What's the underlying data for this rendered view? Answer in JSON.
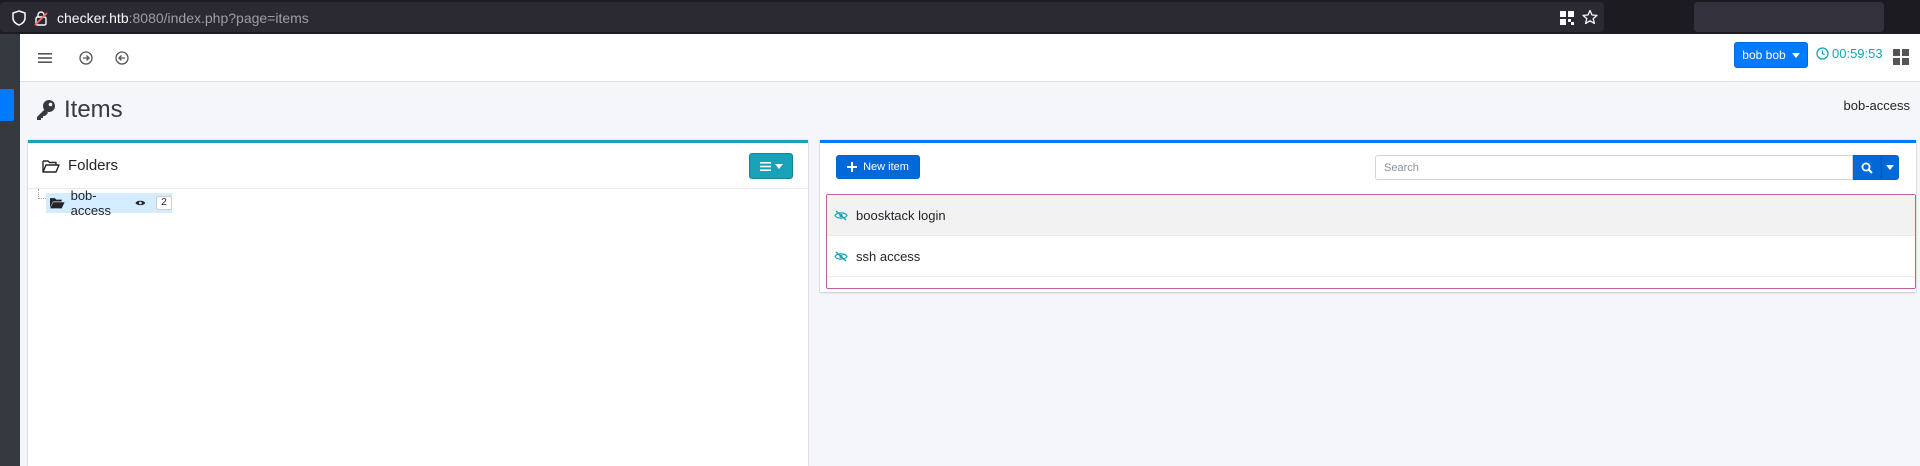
{
  "browser": {
    "url_host": "checker.htb",
    "url_rest": ":8080/index.php?page=items"
  },
  "navbar": {
    "user_label": "bob bob",
    "timer": "00:59:53"
  },
  "page": {
    "title": "Items",
    "breadcrumb": "bob-access"
  },
  "folders": {
    "title": "Folders",
    "tree": [
      {
        "label": "bob-access",
        "count": "2"
      }
    ]
  },
  "items_panel": {
    "new_item_label": "New item",
    "search_placeholder": "Search",
    "items": [
      {
        "label": "boosktack login"
      },
      {
        "label": "ssh access"
      }
    ]
  },
  "colors": {
    "primary": "#007bff",
    "info": "#17a2b8",
    "selection_border": "#c05fa8",
    "tree_selected": "#d4ecff"
  }
}
